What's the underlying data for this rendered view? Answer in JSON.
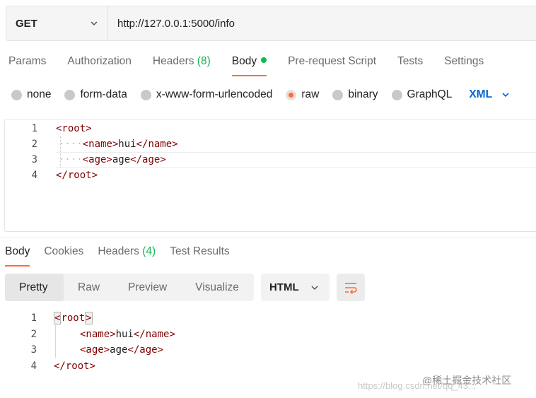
{
  "request": {
    "method": "GET",
    "url": "http://127.0.0.1:5000/info"
  },
  "request_tabs": [
    {
      "label": "Params"
    },
    {
      "label": "Authorization"
    },
    {
      "label": "Headers",
      "count": "(8)"
    },
    {
      "label": "Body",
      "active": true
    },
    {
      "label": "Pre-request Script"
    },
    {
      "label": "Tests"
    },
    {
      "label": "Settings"
    }
  ],
  "body_types": {
    "none": "none",
    "form_data": "form-data",
    "urlencoded": "x-www-form-urlencoded",
    "raw": "raw",
    "binary": "binary",
    "graphql": "GraphQL",
    "selected": "raw",
    "format": "XML"
  },
  "request_body": {
    "line_numbers": [
      "1",
      "2",
      "3",
      "4"
    ],
    "l1_open": "<root>",
    "l2_ws": "····",
    "l2_open": "<name>",
    "l2_text": "hui",
    "l2_close": "</name>",
    "l3_ws": "····",
    "l3_open": "<age>",
    "l3_text": "age",
    "l3_close": "</age>",
    "l4_close": "</root>"
  },
  "response_tabs": [
    {
      "label": "Body",
      "active": true
    },
    {
      "label": "Cookies"
    },
    {
      "label": "Headers",
      "count": "(4)"
    },
    {
      "label": "Test Results"
    }
  ],
  "response_view": {
    "modes": [
      "Pretty",
      "Raw",
      "Preview",
      "Visualize"
    ],
    "active": "Pretty",
    "format": "HTML"
  },
  "response_body": {
    "line_numbers": [
      "1",
      "2",
      "3",
      "4"
    ],
    "l1_open": "<root>",
    "l2_open": "<name>",
    "l2_text": "hui",
    "l2_close": "</name>",
    "l3_open": "<age>",
    "l3_text": "age",
    "l3_close": "</age>",
    "l4_close": "</root>"
  },
  "watermark": {
    "brand": "@稀土掘金技术社区",
    "url": "https://blog.csdn.net/qq_43..."
  },
  "colors": {
    "accent": "#ff6c37",
    "count_green": "#0cbb52",
    "xml_blue": "#0265d2",
    "tag": "#800000"
  }
}
